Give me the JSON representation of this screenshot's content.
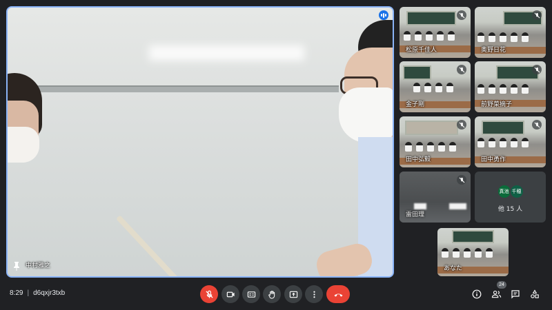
{
  "main_speaker": {
    "name": "中村雅之"
  },
  "participants": [
    {
      "name": "松原千佳人"
    },
    {
      "name": "奥野日花"
    },
    {
      "name": "金子剛"
    },
    {
      "name": "前野菜摘子"
    },
    {
      "name": "田中弘毅"
    },
    {
      "name": "田中勇作"
    },
    {
      "name": "雷田理"
    }
  ],
  "overflow": {
    "avatars": [
      "真池",
      "千穂"
    ],
    "label": "他 15 人"
  },
  "self_view": {
    "name": "あなた"
  },
  "bottom_bar": {
    "time": "8:29",
    "separator": "|",
    "meeting_code": "d6qxjr3txb",
    "participant_count": "24"
  },
  "colors": {
    "accent": "#8ab4f8",
    "end_call": "#ea4335",
    "mic_off": "#ea4335"
  }
}
